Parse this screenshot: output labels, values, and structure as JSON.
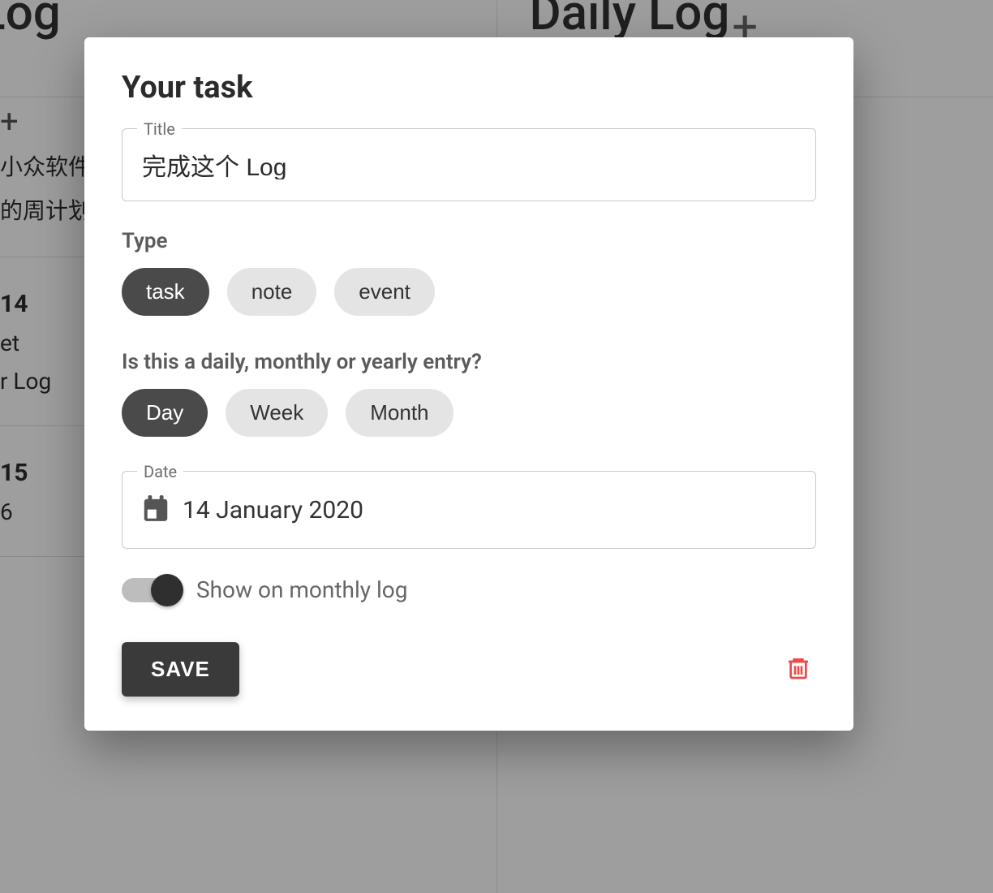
{
  "background": {
    "column_left": {
      "title_partial": "y Log",
      "plus": "+",
      "lines": [
        "小众软件",
        "的周计划"
      ],
      "days": [
        {
          "num": "14",
          "items": [
            "et",
            "r Log"
          ]
        },
        {
          "num": "15",
          "items": [
            "6"
          ]
        }
      ]
    },
    "column_right": {
      "title": "Daily Log",
      "header_plus": "+"
    }
  },
  "modal": {
    "heading": "Your task",
    "title_field": {
      "label": "Title",
      "value": "完成这个 Log"
    },
    "type_section": {
      "label": "Type",
      "options": [
        "task",
        "note",
        "event"
      ],
      "selected": "task"
    },
    "period_section": {
      "label": "Is this a daily, monthly or yearly entry?",
      "options": [
        "Day",
        "Week",
        "Month"
      ],
      "selected": "Day"
    },
    "date_field": {
      "label": "Date",
      "value": "14 January 2020"
    },
    "toggle": {
      "label": "Show on monthly log",
      "on": true
    },
    "save_label": "SAVE"
  }
}
